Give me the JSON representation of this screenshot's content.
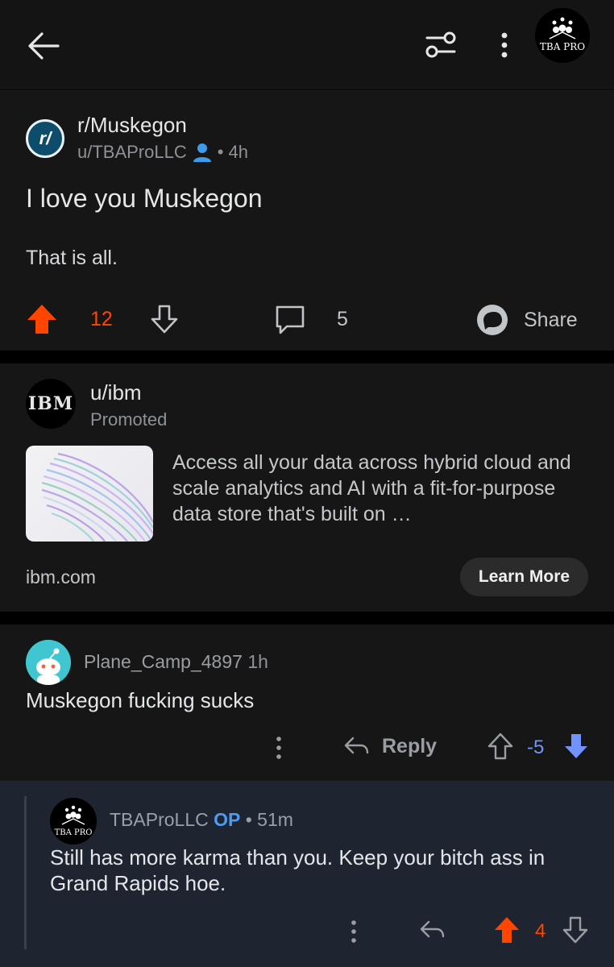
{
  "header": {
    "back_icon": "arrow-left-icon",
    "filter_icon": "sliders-icon",
    "menu_icon": "vertical-dots-icon",
    "avatar_text": "TBA PRO"
  },
  "post": {
    "subreddit": "r/Muskegon",
    "subreddit_icon_text": "r/",
    "author": "u/TBAProLLC",
    "age": "• 4h",
    "title": "I love you Muskegon",
    "body": "That is all.",
    "score": "12",
    "comment_count": "5",
    "share_label": "Share",
    "upvote_color": "#ff4500"
  },
  "ad": {
    "logo_text": "IBM",
    "user": "u/ibm",
    "promoted_label": "Promoted",
    "text": "Access all your data across hybrid cloud and scale analytics and AI with a fit-for-purpose data store that's built on …",
    "domain": "ibm.com",
    "cta_label": "Learn More"
  },
  "comments": [
    {
      "user": "Plane_Camp_4897",
      "age": "1h",
      "body": "Muskegon fucking sucks",
      "reply_label": "Reply",
      "score": "-5",
      "vote_color": "#7193ff"
    },
    {
      "user": "TBAProLLC",
      "op_label": "OP",
      "age": "• 51m",
      "body": "Still has more karma than you. Keep your bitch ass in Grand Rapids hoe.",
      "score": "4",
      "avatar_text": "TBA PRO",
      "vote_color": "#ff4500"
    }
  ]
}
